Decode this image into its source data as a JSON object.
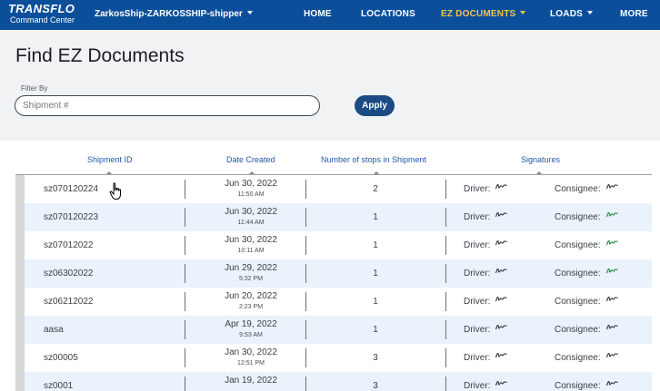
{
  "nav": {
    "brand": "TRANSFLO",
    "brand_sub": "Command Center",
    "account": "ZarkosShip-ZARKOSSHIP-shipper",
    "home": "HOME",
    "locations": "LOCATIONS",
    "ez_documents": "EZ DOCUMENTS",
    "loads": "LOADS",
    "more": "MORE"
  },
  "page": {
    "title": "Find EZ Documents",
    "filter_label": "Filter By",
    "filter_placeholder": "Shipment #",
    "filter_value": "",
    "apply_label": "Apply"
  },
  "table": {
    "columns": [
      "Shipment ID",
      "Date Created",
      "Number of stops in Shipment",
      "Signatures"
    ],
    "driver_label": "Driver:",
    "consignee_label": "Consignee:",
    "rows": [
      {
        "id": "sz070120224",
        "date": "Jun 30, 2022",
        "time": "11:50 AM",
        "stops": "2"
      },
      {
        "id": "sz070120223",
        "date": "Jun 30, 2022",
        "time": "11:44 AM",
        "stops": "1"
      },
      {
        "id": "sz07012022",
        "date": "Jun 30, 2022",
        "time": "10:11 AM",
        "stops": "1"
      },
      {
        "id": "sz06302022",
        "date": "Jun 29, 2022",
        "time": "5:32 PM",
        "stops": "1"
      },
      {
        "id": "sz06212022",
        "date": "Jun 20, 2022",
        "time": "2:23 PM",
        "stops": "1"
      },
      {
        "id": "aasa",
        "date": "Apr 19, 2022",
        "time": "9:53 AM",
        "stops": "1"
      },
      {
        "id": "sz00005",
        "date": "Jan 30, 2022",
        "time": "12:51 PM",
        "stops": "3"
      },
      {
        "id": "sz0001",
        "date": "Jan 19, 2022",
        "time": "",
        "stops": "3"
      }
    ]
  },
  "colors": {
    "nav_bg": "#0b4f9a",
    "nav_active": "#f4c34d",
    "apply_bg": "#1c4b84",
    "row_alt": "#eaf2fb",
    "sig_green": "#1f8a3a",
    "sig_dark": "#2c3640"
  },
  "icons": {
    "signature": "signature-scribble-icon",
    "cursor": "hand-pointer-cursor-icon",
    "sort": "sort-caret-up-icon"
  }
}
